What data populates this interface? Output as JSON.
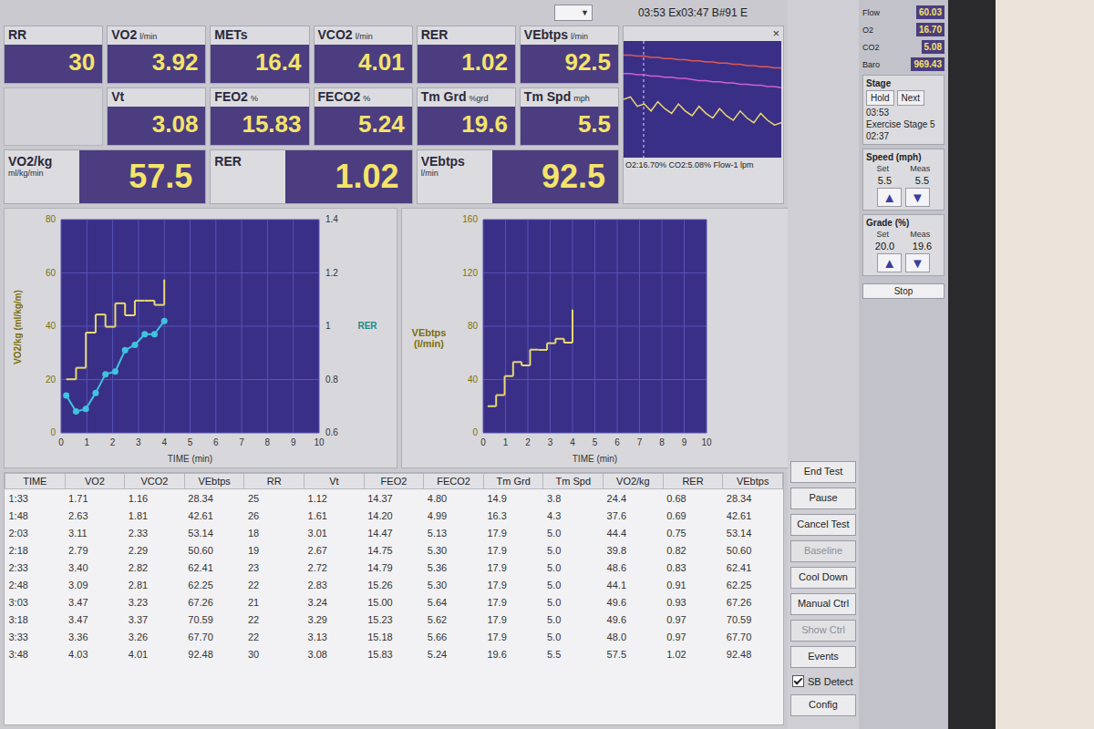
{
  "header": {
    "dropdown_arrow": "▼",
    "timer": "03:53 Ex03:47 B#91 E"
  },
  "tiles_top": [
    {
      "label": "RR",
      "value": "30"
    },
    {
      "label": "VO2",
      "unit": "l/min",
      "value": "3.92"
    },
    {
      "label": "METs",
      "value": "16.4"
    },
    {
      "label": "VCO2",
      "unit": "l/min",
      "value": "4.01"
    },
    {
      "label": "RER",
      "value": "1.02"
    },
    {
      "label": "VEbtps",
      "unit": "l/min",
      "value": "92.5"
    }
  ],
  "tiles_middle": [
    {
      "label": "Vt",
      "value": "3.08"
    },
    {
      "label": "FEO2",
      "unit": "%",
      "value": "15.83"
    },
    {
      "label": "FECO2",
      "unit": "%",
      "value": "5.24"
    },
    {
      "label": "Tm Grd",
      "unit": "%grd",
      "value": "19.6"
    },
    {
      "label": "Tm Spd",
      "unit": "mph",
      "value": "5.5"
    }
  ],
  "tiles_big": [
    {
      "label": "VO2/kg",
      "unit": "ml/kg/min",
      "value": "57.5"
    },
    {
      "label": "RER",
      "value": "1.02"
    },
    {
      "label": "VEbtps",
      "unit": "l/min",
      "value": "92.5"
    }
  ],
  "trace": {
    "close": "×",
    "footer": "O2:16.70% CO2:5.08% Flow-1 lpm",
    "series": [
      {
        "color": "#e05a50",
        "values": [
          88,
          88,
          87,
          87,
          86,
          86,
          85,
          85,
          84,
          84,
          83,
          83,
          82,
          82,
          81,
          81,
          80,
          80,
          79,
          79,
          78,
          78,
          77,
          77
        ]
      },
      {
        "color": "#d060d0",
        "values": [
          72,
          72,
          71,
          71,
          70,
          70,
          69,
          69,
          68,
          68,
          67,
          66,
          66,
          65,
          65,
          64,
          64,
          63,
          63,
          62,
          62,
          61,
          61,
          60
        ]
      },
      {
        "color": "#e8d870",
        "values": [
          50,
          52,
          44,
          46,
          40,
          48,
          42,
          38,
          46,
          40,
          36,
          44,
          38,
          34,
          42,
          36,
          32,
          40,
          34,
          30,
          38,
          32,
          28,
          30
        ]
      }
    ]
  },
  "chart_left": {
    "y_label": "VO2/kg (ml/kg/m)",
    "y_ticks": [
      "0",
      "20",
      "40",
      "60",
      "80"
    ],
    "y2_label": "RER",
    "y2_ticks": [
      "0.6",
      "0.8",
      "1",
      "1.2",
      "1.4"
    ],
    "x_ticks": [
      "0",
      "1",
      "2",
      "3",
      "4",
      "5",
      "6",
      "7",
      "8",
      "9",
      "10"
    ],
    "x_label": "TIME (min)",
    "series": [
      {
        "axis": "left",
        "kind": "step",
        "color": "#e8d870",
        "x": [
          0.2,
          0.58,
          0.96,
          1.34,
          1.72,
          2.1,
          2.48,
          2.86,
          3.24,
          3.62,
          4.0
        ],
        "y": [
          20.1,
          24.4,
          37.6,
          44.4,
          39.8,
          48.6,
          44.1,
          49.6,
          49.6,
          48.0,
          57.5
        ]
      },
      {
        "axis": "right",
        "kind": "markers",
        "color": "#3fc4e0",
        "x": [
          0.2,
          0.58,
          0.96,
          1.34,
          1.72,
          2.1,
          2.48,
          2.86,
          3.24,
          3.62,
          4.0
        ],
        "y": [
          0.74,
          0.68,
          0.69,
          0.75,
          0.82,
          0.83,
          0.91,
          0.93,
          0.97,
          0.97,
          1.02
        ]
      }
    ]
  },
  "chart_right": {
    "y_label": "VEbtps (l/min)",
    "y_ticks": [
      "0",
      "40",
      "80",
      "120",
      "160"
    ],
    "x_ticks": [
      "0",
      "1",
      "2",
      "3",
      "4",
      "5",
      "6",
      "7",
      "8",
      "9",
      "10"
    ],
    "x_label": "TIME (min)",
    "series": [
      {
        "axis": "left",
        "kind": "step",
        "color": "#e8d870",
        "x": [
          0.2,
          0.58,
          0.96,
          1.34,
          1.72,
          2.1,
          2.48,
          2.86,
          3.24,
          3.62,
          4.0
        ],
        "y": [
          20,
          28.34,
          42.61,
          53.14,
          50.6,
          62.41,
          62.25,
          67.26,
          70.59,
          67.7,
          92.48
        ]
      }
    ]
  },
  "table": {
    "columns": [
      "TIME",
      "VO2",
      "VCO2",
      "VEbtps",
      "RR",
      "Vt",
      "FEO2",
      "FECO2",
      "Tm Grd",
      "Tm Spd",
      "VO2/kg",
      "RER",
      "VEbtps"
    ],
    "rows": [
      [
        "1:33",
        "1.71",
        "1.16",
        "28.34",
        "25",
        "1.12",
        "14.37",
        "4.80",
        "14.9",
        "3.8",
        "24.4",
        "0.68",
        "28.34"
      ],
      [
        "1:48",
        "2.63",
        "1.81",
        "42.61",
        "26",
        "1.61",
        "14.20",
        "4.99",
        "16.3",
        "4.3",
        "37.6",
        "0.69",
        "42.61"
      ],
      [
        "2:03",
        "3.11",
        "2.33",
        "53.14",
        "18",
        "3.01",
        "14.47",
        "5.13",
        "17.9",
        "5.0",
        "44.4",
        "0.75",
        "53.14"
      ],
      [
        "2:18",
        "2.79",
        "2.29",
        "50.60",
        "19",
        "2.67",
        "14.75",
        "5.30",
        "17.9",
        "5.0",
        "39.8",
        "0.82",
        "50.60"
      ],
      [
        "2:33",
        "3.40",
        "2.82",
        "62.41",
        "23",
        "2.72",
        "14.79",
        "5.36",
        "17.9",
        "5.0",
        "48.6",
        "0.83",
        "62.41"
      ],
      [
        "2:48",
        "3.09",
        "2.81",
        "62.25",
        "22",
        "2.83",
        "15.26",
        "5.30",
        "17.9",
        "5.0",
        "44.1",
        "0.91",
        "62.25"
      ],
      [
        "3:03",
        "3.47",
        "3.23",
        "67.26",
        "21",
        "3.24",
        "15.00",
        "5.64",
        "17.9",
        "5.0",
        "49.6",
        "0.93",
        "67.26"
      ],
      [
        "3:18",
        "3.47",
        "3.37",
        "70.59",
        "22",
        "3.29",
        "15.23",
        "5.62",
        "17.9",
        "5.0",
        "49.6",
        "0.97",
        "70.59"
      ],
      [
        "3:33",
        "3.36",
        "3.26",
        "67.70",
        "22",
        "3.13",
        "15.18",
        "5.66",
        "17.9",
        "5.0",
        "48.0",
        "0.97",
        "67.70"
      ],
      [
        "3:48",
        "4.03",
        "4.01",
        "92.48",
        "30",
        "3.08",
        "15.83",
        "5.24",
        "19.6",
        "5.5",
        "57.5",
        "1.02",
        "92.48"
      ]
    ]
  },
  "controls": [
    {
      "label": "End Test",
      "kind": "button",
      "disabled": false
    },
    {
      "label": "Pause",
      "kind": "button",
      "disabled": false
    },
    {
      "label": "Cancel Test",
      "kind": "button",
      "disabled": false
    },
    {
      "label": "Baseline",
      "kind": "button",
      "disabled": true
    },
    {
      "label": "Cool Down",
      "kind": "button",
      "disabled": false
    },
    {
      "label": "Manual Ctrl",
      "kind": "button",
      "disabled": false
    },
    {
      "label": "Show Ctrl",
      "kind": "button",
      "disabled": true
    },
    {
      "label": "Events",
      "kind": "button",
      "disabled": false
    },
    {
      "label": "SB Detect",
      "kind": "checkbox",
      "disabled": false,
      "checked": true
    },
    {
      "label": "Config",
      "kind": "button",
      "disabled": false
    }
  ],
  "side": {
    "readouts": [
      {
        "label": "Flow",
        "value": "60.03"
      },
      {
        "label": "O2",
        "value": "16.70"
      },
      {
        "label": "CO2",
        "value": "5.08"
      },
      {
        "label": "Baro",
        "value": "969.43"
      }
    ],
    "stage_title": "Stage",
    "hold": "Hold",
    "next": "Next",
    "clock": "03:53",
    "stage_name": "Exercise Stage 5",
    "stage_time": "02:37",
    "speed": {
      "label": "Speed (mph)",
      "set_label": "Set",
      "meas_label": "Meas",
      "set": "5.5",
      "meas": "5.5",
      "arrows": [
        "▲",
        "▼"
      ]
    },
    "grade": {
      "label": "Grade (%)",
      "set_label": "Set",
      "meas_label": "Meas",
      "set": "20.0",
      "meas": "19.6",
      "arrows": [
        "▲",
        "▼"
      ]
    },
    "stop": "Stop"
  }
}
